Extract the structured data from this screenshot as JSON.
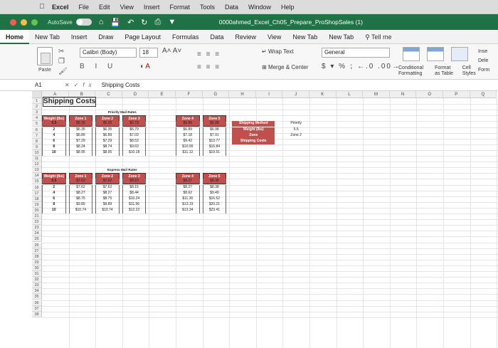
{
  "menubar": {
    "app_name": "Excel",
    "items": [
      "File",
      "Edit",
      "View",
      "Insert",
      "Format",
      "Tools",
      "Data",
      "Window",
      "Help"
    ]
  },
  "titlebar": {
    "autosave_label": "AutoSave",
    "autosave_state": "OFF",
    "document_title": "0000ahmed_Excel_Ch05_Prepare_ProShopSales (1)"
  },
  "ribbon_tabs": [
    "Home",
    "New Tab",
    "Insert",
    "Draw",
    "Page Layout",
    "Formulas",
    "Data",
    "Review",
    "View",
    "New Tab",
    "New Tab",
    "Tell me"
  ],
  "ribbon": {
    "paste_label": "Paste",
    "font_name": "Calibri (Body)",
    "font_size": "18",
    "grow_shrink": "A˄  A˅",
    "bold_italic_underline": "B I U",
    "wrap_text": "Wrap Text",
    "merge_center": "Merge & Center",
    "number_format": "General",
    "number_symbols": "$ ▾ % ⁏   ←.0  .00→",
    "conditional_formatting": "Conditional Formatting",
    "format_as_table": "Format as Table",
    "cell_styles": "Cell Styles",
    "insert": "Inse",
    "delete": "Dele",
    "format": "Form"
  },
  "formula_bar": {
    "name_box": "A1",
    "content": "Shipping Costs"
  },
  "columns": [
    "A",
    "B",
    "C",
    "D",
    "E",
    "F",
    "G",
    "H",
    "I",
    "J",
    "K",
    "L",
    "M",
    "N",
    "O",
    "P",
    "Q"
  ],
  "rows": [
    "1",
    "2",
    "3",
    "4",
    "5",
    "6",
    "7",
    "8",
    "9",
    "10",
    "11",
    "12",
    "13",
    "14",
    "15",
    "16",
    "17",
    "18",
    "19",
    "20",
    "21",
    "22",
    "23",
    "24",
    "25",
    "26",
    "27",
    "28",
    "29",
    "30",
    "31",
    "32",
    "33",
    "34",
    "35",
    "36",
    "37",
    "38"
  ],
  "sheet": {
    "title": "Shipping Costs",
    "priority_header": "Priority Mail Rates",
    "express_header": "Express Mail Rates",
    "table_headers": [
      "Weight (lbs)",
      "Zone 1",
      "Zone 2",
      "Zone 3",
      "Zone 4",
      "Zone 5"
    ],
    "priority_rows": [
      [
        "0.5",
        "$6.35",
        "$6.35",
        "$6.79",
        "$6.89",
        "$6.98"
      ],
      [
        "2",
        "$6.35",
        "$6.35",
        "$6.79",
        "$6.89",
        "$6.98"
      ],
      [
        "4",
        "$6.89",
        "$6.89",
        "$7.03",
        "$7.18",
        "$7.91"
      ],
      [
        "6",
        "$7.29",
        "$7.29",
        "$8.53",
        "$9.42",
        "$13.77"
      ],
      [
        "8",
        "$8.24",
        "$8.74",
        "$9.63",
        "$10.99",
        "$16.84"
      ],
      [
        "10",
        "$8.95",
        "$8.95",
        "$10.18",
        "$11.12",
        "$19.51"
      ]
    ],
    "express_rows": [
      [
        "0.5",
        "$7.62",
        "$7.62",
        "$8.15",
        "$8.27",
        "$8.38"
      ],
      [
        "2",
        "$7.62",
        "$7.62",
        "$8.15",
        "$8.27",
        "$8.38"
      ],
      [
        "4",
        "$8.27",
        "$8.27",
        "$8.44",
        "$8.62",
        "$9.49"
      ],
      [
        "6",
        "$8.75",
        "$8.75",
        "$10.24",
        "$11.30",
        "$16.52"
      ],
      [
        "8",
        "$9.89",
        "$9.89",
        "$11.56",
        "$13.19",
        "$20.21"
      ],
      [
        "10",
        "$10.74",
        "$10.74",
        "$12.22",
        "$13.34",
        "$23.41"
      ]
    ],
    "lookup": {
      "labels": [
        "Shipping Method",
        "Weight (lbs)",
        "Zone",
        "Shipping Costs"
      ],
      "priority_label": "Priority",
      "weight_value": "5.5",
      "zone_value": "Zone 2"
    }
  },
  "colors": {
    "excel_green": "#1f7245",
    "header_red": "#c0504d"
  }
}
